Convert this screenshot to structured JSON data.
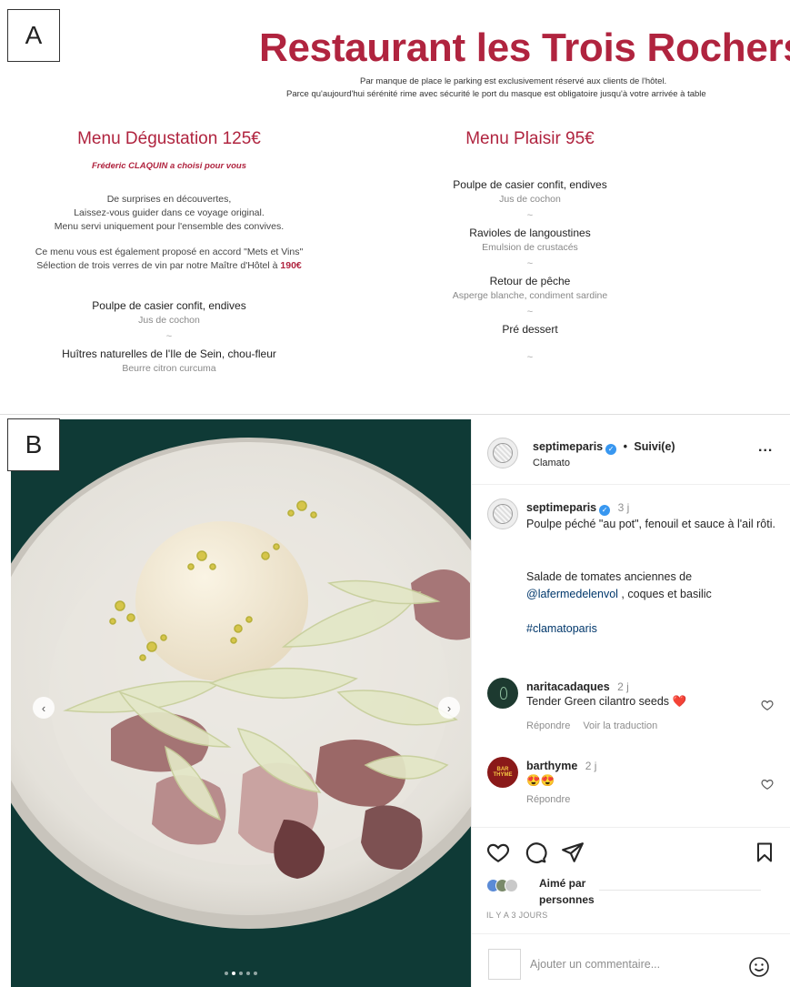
{
  "panel_a": {
    "label": "A",
    "title": "Restaurant les Trois Rochers",
    "notes": [
      "Par manque de place le parking est exclusivement réservé aux clients de l'hôtel.",
      "Parce qu'aujourd'hui sérénité rime avec sécurité le port du masque est obligatoire jusqu'à votre arrivée à table"
    ],
    "menu_degustation": {
      "title": "Menu Dégustation 125€",
      "subtitle": "Fréderic CLAQUIN a choisi pour vous",
      "intro_lines": [
        "De surprises en découvertes,",
        "Laissez-vous guider dans ce voyage original.",
        "Menu servi uniquement pour l'ensemble des convives."
      ],
      "pairing_line1": "Ce menu vous est également proposé en accord \"Mets et Vins\"",
      "pairing_line2": "Sélection de trois verres de vin par notre Maître d'Hôtel à",
      "pairing_price": "190€",
      "dishes": [
        {
          "name": "Poulpe de casier confit, endives",
          "sub": "Jus de cochon"
        },
        {
          "name": "Huîtres naturelles de l'Ile de Sein, chou-fleur",
          "sub": "Beurre citron curcuma"
        }
      ]
    },
    "menu_plaisir": {
      "title": "Menu Plaisir 95€",
      "dishes": [
        {
          "name": "Poulpe de casier confit, endives",
          "sub": "Jus de cochon"
        },
        {
          "name": "Ravioles de langoustines",
          "sub": "Emulsion de crustacés"
        },
        {
          "name": "Retour de pêche",
          "sub": "Asperge blanche, condiment sardine"
        },
        {
          "name": "Pré dessert",
          "sub": ""
        }
      ],
      "separator": "~"
    }
  },
  "panel_b": {
    "label": "B",
    "header": {
      "username": "septimeparis",
      "separator": "•",
      "follow_status": "Suivi(e)",
      "location": "Clamato",
      "more": "..."
    },
    "caption": {
      "username": "septimeparis",
      "time": "3 j",
      "text1": "Poulpe péché \"au pot\", fenouil et sauce à l'ail rôti.",
      "text2_prefix": "Salade de tomates anciennes de",
      "mention": "@lafermedelenvol",
      "text2_suffix": ", coques et basilic",
      "hashtag": "#clamatoparis"
    },
    "comments": [
      {
        "username": "naritacadaques",
        "time": "2 j",
        "text": "Tender Green cilantro seeds",
        "emoji": "❤️",
        "reply": "Répondre",
        "translate": "Voir la traduction"
      },
      {
        "username": "barthyme",
        "time": "2 j",
        "avatar_text": "BAR THYME",
        "text": "",
        "emoji": "😍😍",
        "reply": "Répondre"
      }
    ],
    "likes": {
      "prefix": "Aimé par",
      "suffix": "personnes"
    },
    "posted": "IL Y A 3 JOURS",
    "comment_placeholder": "Ajouter un commentaire...",
    "carousel": {
      "count": 5,
      "active_index": 1
    },
    "colors": {
      "brand_red": "#b0243f",
      "link_blue": "#00376b",
      "verified_blue": "#3897f0",
      "photo_background": "#0f3a36"
    },
    "icons": [
      "heart-icon",
      "comment-icon",
      "share-icon",
      "bookmark-icon",
      "smile-icon",
      "verified-icon",
      "chevron-left-icon",
      "chevron-right-icon"
    ]
  }
}
